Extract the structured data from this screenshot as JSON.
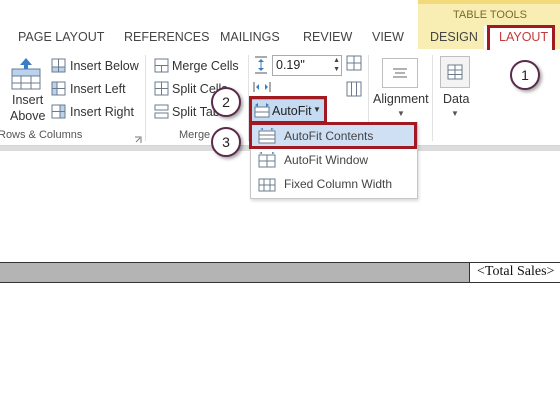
{
  "tabs": [
    {
      "label": "PAGE LAYOUT"
    },
    {
      "label": "REFERENCES"
    },
    {
      "label": "MAILINGS"
    },
    {
      "label": "REVIEW"
    },
    {
      "label": "VIEW"
    },
    {
      "label": "DESIGN"
    },
    {
      "label": "LAYOUT"
    }
  ],
  "contextual_header": "TABLE TOOLS",
  "rows_columns": {
    "insert_above_line1": "Insert",
    "insert_above_line2": "Above",
    "insert_below": "Insert Below",
    "insert_left": "Insert Left",
    "insert_right": "Insert Right",
    "group_label": "Rows & Columns"
  },
  "merge": {
    "merge_cells": "Merge Cells",
    "split_cells": "Split Cells",
    "split_table": "Split Table",
    "group_label": "Merge"
  },
  "cell_size": {
    "height_value": "0.19\"",
    "autofit_label": "AutoFit"
  },
  "alignment_label": "Alignment",
  "data_label": "Data",
  "autofit_menu": {
    "items": [
      {
        "label": "AutoFit Contents",
        "selected": true
      },
      {
        "label": "AutoFit Window",
        "selected": false
      },
      {
        "label": "Fixed Column Width",
        "selected": false
      }
    ]
  },
  "callouts": [
    "1",
    "2",
    "3"
  ],
  "document": {
    "table_cell_text": "<Total Sales>"
  },
  "colors": {
    "accent_red": "#a11a22",
    "table_tools_bg": "#f8eeb4",
    "menu_highlight": "#cfe0f5"
  }
}
